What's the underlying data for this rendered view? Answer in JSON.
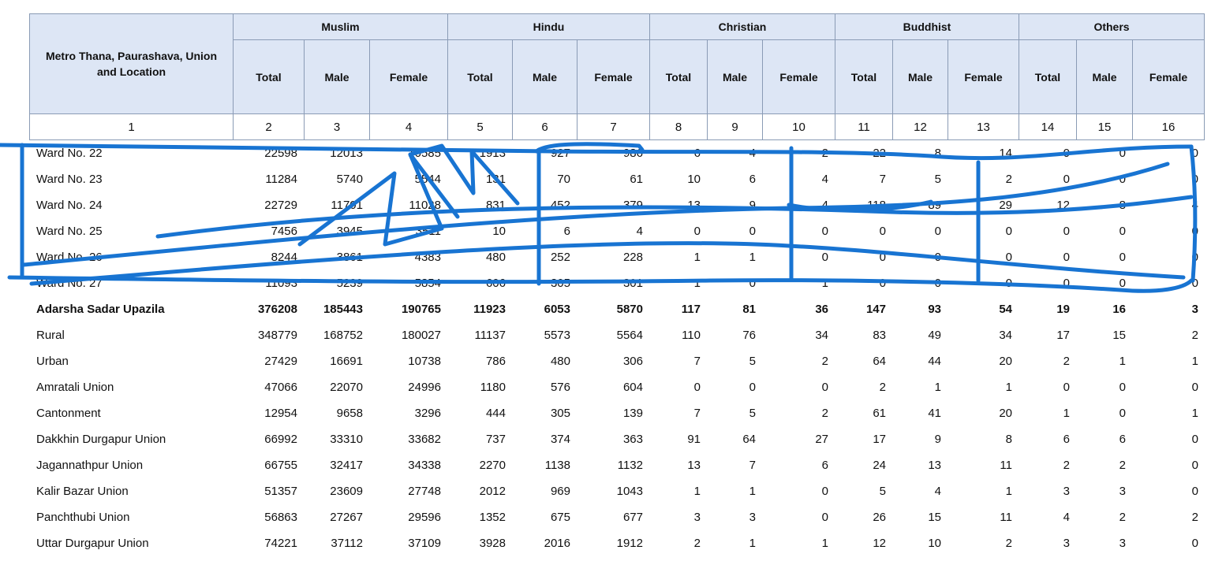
{
  "header": {
    "location_label": "Metro Thana, Paurashava, Union and Location",
    "religions": [
      "Muslim",
      "Hindu",
      "Christian",
      "Buddhist",
      "Others"
    ],
    "sub_labels": [
      "Total",
      "Male",
      "Female"
    ],
    "column_numbers": [
      "1",
      "2",
      "3",
      "4",
      "5",
      "6",
      "7",
      "8",
      "9",
      "10",
      "11",
      "12",
      "13",
      "14",
      "15",
      "16"
    ]
  },
  "rows": [
    {
      "name": "Ward No. 22",
      "cells": [
        "22598",
        "12013",
        "10585",
        "1913",
        "927",
        "986",
        "6",
        "4",
        "2",
        "22",
        "8",
        "14",
        "0",
        "0",
        "0"
      ],
      "bold": false
    },
    {
      "name": "Ward No. 23",
      "cells": [
        "11284",
        "5740",
        "5544",
        "131",
        "70",
        "61",
        "10",
        "6",
        "4",
        "7",
        "5",
        "2",
        "0",
        "0",
        "0"
      ],
      "bold": false
    },
    {
      "name": "Ward No. 24",
      "cells": [
        "22729",
        "11701",
        "11028",
        "831",
        "452",
        "379",
        "13",
        "9",
        "4",
        "118",
        "89",
        "29",
        "12",
        "8",
        "4"
      ],
      "bold": false
    },
    {
      "name": "Ward No. 25",
      "cells": [
        "7456",
        "3945",
        "3511",
        "10",
        "6",
        "4",
        "0",
        "0",
        "0",
        "0",
        "0",
        "0",
        "0",
        "0",
        "0"
      ],
      "bold": false
    },
    {
      "name": "Ward No. 26",
      "cells": [
        "8244",
        "3861",
        "4383",
        "480",
        "252",
        "228",
        "1",
        "1",
        "0",
        "0",
        "0",
        "0",
        "0",
        "0",
        "0"
      ],
      "bold": false
    },
    {
      "name": "Ward No. 27",
      "cells": [
        "11093",
        "5239",
        "5854",
        "606",
        "305",
        "301",
        "1",
        "0",
        "1",
        "0",
        "0",
        "0",
        "0",
        "0",
        "0"
      ],
      "bold": false
    },
    {
      "name": "Adarsha Sadar Upazila",
      "cells": [
        "376208",
        "185443",
        "190765",
        "11923",
        "6053",
        "5870",
        "117",
        "81",
        "36",
        "147",
        "93",
        "54",
        "19",
        "16",
        "3"
      ],
      "bold": true
    },
    {
      "name": "Rural",
      "cells": [
        "348779",
        "168752",
        "180027",
        "11137",
        "5573",
        "5564",
        "110",
        "76",
        "34",
        "83",
        "49",
        "34",
        "17",
        "15",
        "2"
      ],
      "bold": false
    },
    {
      "name": "Urban",
      "cells": [
        "27429",
        "16691",
        "10738",
        "786",
        "480",
        "306",
        "7",
        "5",
        "2",
        "64",
        "44",
        "20",
        "2",
        "1",
        "1"
      ],
      "bold": false
    },
    {
      "name": "Amratali Union",
      "cells": [
        "47066",
        "22070",
        "24996",
        "1180",
        "576",
        "604",
        "0",
        "0",
        "0",
        "2",
        "1",
        "1",
        "0",
        "0",
        "0"
      ],
      "bold": false
    },
    {
      "name": "Cantonment",
      "cells": [
        "12954",
        "9658",
        "3296",
        "444",
        "305",
        "139",
        "7",
        "5",
        "2",
        "61",
        "41",
        "20",
        "1",
        "0",
        "1"
      ],
      "bold": false
    },
    {
      "name": "Dakkhin Durgapur Union",
      "cells": [
        "66992",
        "33310",
        "33682",
        "737",
        "374",
        "363",
        "91",
        "64",
        "27",
        "17",
        "9",
        "8",
        "6",
        "6",
        "0"
      ],
      "bold": false
    },
    {
      "name": "Jagannathpur Union",
      "cells": [
        "66755",
        "32417",
        "34338",
        "2270",
        "1138",
        "1132",
        "13",
        "7",
        "6",
        "24",
        "13",
        "11",
        "2",
        "2",
        "0"
      ],
      "bold": false
    },
    {
      "name": "Kalir Bazar Union",
      "cells": [
        "51357",
        "23609",
        "27748",
        "2012",
        "969",
        "1043",
        "1",
        "1",
        "0",
        "5",
        "4",
        "1",
        "3",
        "3",
        "0"
      ],
      "bold": false
    },
    {
      "name": "Panchthubi Union",
      "cells": [
        "56863",
        "27267",
        "29596",
        "1352",
        "675",
        "677",
        "3",
        "3",
        "0",
        "26",
        "15",
        "11",
        "4",
        "2",
        "2"
      ],
      "bold": false
    },
    {
      "name": "Uttar Durgapur Union",
      "cells": [
        "74221",
        "37112",
        "37109",
        "3928",
        "2016",
        "1912",
        "2",
        "1",
        "1",
        "12",
        "10",
        "2",
        "3",
        "3",
        "0"
      ],
      "bold": false
    }
  ],
  "colors": {
    "header_fill": "#dde6f5",
    "border": "#8a9bb5",
    "annotation_stroke": "#1874d2"
  }
}
